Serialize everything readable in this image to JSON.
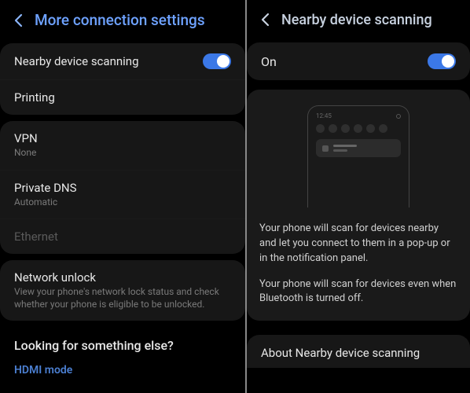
{
  "left": {
    "title": "More connection settings",
    "sections": [
      {
        "rows": [
          {
            "label": "Nearby device scanning",
            "toggle": true
          },
          {
            "label": "Printing"
          }
        ]
      },
      {
        "rows": [
          {
            "label": "VPN",
            "sub": "None"
          },
          {
            "label": "Private DNS",
            "sub": "Automatic"
          },
          {
            "label": "Ethernet",
            "disabled": true
          }
        ]
      },
      {
        "rows": [
          {
            "label": "Network unlock",
            "sub": "View your phone's network lock status and check whether your phone is eligible to be unlocked."
          }
        ]
      }
    ],
    "looking": "Looking for something else?",
    "link": "HDMI mode"
  },
  "right": {
    "title": "Nearby device scanning",
    "on_label": "On",
    "mock_time": "12:45",
    "desc1": "Your phone will scan for devices nearby and let you connect to them in a pop-up or in the notification panel.",
    "desc2": "Your phone will scan for devices even when Bluetooth is turned off.",
    "about": "About Nearby device scanning"
  }
}
